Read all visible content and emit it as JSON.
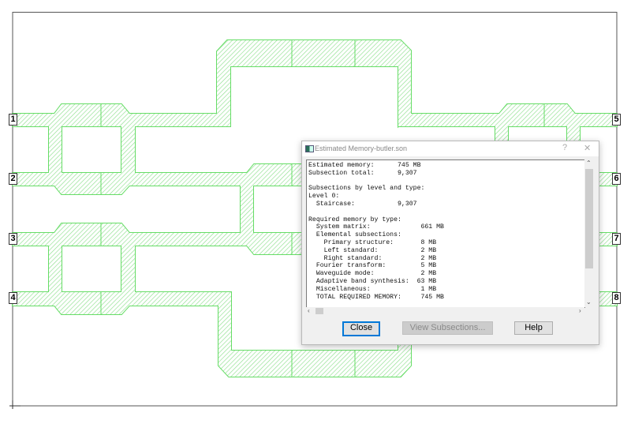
{
  "canvas": {
    "ports": [
      "1",
      "2",
      "3",
      "4",
      "5",
      "6",
      "7",
      "8"
    ],
    "trace_color": "#66dd66"
  },
  "dialog": {
    "title": "Estimated Memory-butler.son",
    "help_glyph": "?",
    "close_glyph": "✕",
    "report_lines": [
      "Estimated memory:      745 MB",
      "Subsection total:      9,307",
      "",
      "Subsections by level and type:",
      "Level 0:",
      "  Staircase:           9,307",
      "",
      "Required memory by type:",
      "  System matrix:             661 MB",
      "  Elemental subsections:",
      "    Primary structure:       8 MB",
      "    Left standard:           2 MB",
      "    Right standard:          2 MB",
      "  Fourier transform:         5 MB",
      "  Waveguide mode:            2 MB",
      "  Adaptive band synthesis:  63 MB",
      "  Miscellaneous:             1 MB",
      "  TOTAL REQUIRED MEMORY:     745 MB"
    ],
    "buttons": {
      "close": "Close",
      "view_subsections": "View Subsections...",
      "help": "Help"
    }
  }
}
